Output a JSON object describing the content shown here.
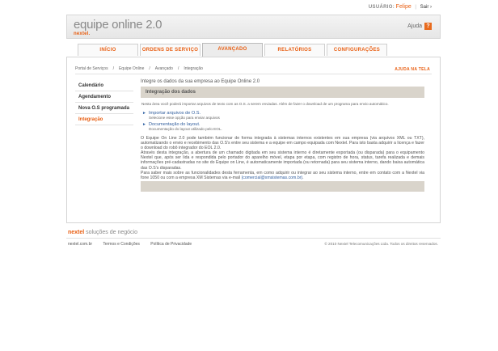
{
  "user_bar": {
    "label": "USUÁRIO:",
    "name": "Felipe",
    "separator": "|",
    "logout": "Sair ›"
  },
  "header": {
    "title": "equipe online 2.0",
    "brand": "nextel.",
    "help_label": "Ajuda",
    "help_icon": "?"
  },
  "tabs": [
    {
      "label": "INÍCIO"
    },
    {
      "label": "ORDENS DE SERVIÇO"
    },
    {
      "label": "AVANÇADO"
    },
    {
      "label": "RELATÓRIOS"
    },
    {
      "label": "CONFIGURAÇÕES"
    }
  ],
  "breadcrumb": [
    "Portal de Serviços",
    "Equipe Online",
    "Avançado",
    "Integração"
  ],
  "breadcrumb_sep": "/",
  "help_screen": "AJUDA NA TELA",
  "sidebar": {
    "items": [
      {
        "label": "Calendário"
      },
      {
        "label": "Agendamento"
      },
      {
        "label": "Nova O.S programada"
      },
      {
        "label": "Integração"
      }
    ]
  },
  "main": {
    "intro": "Integre os dados da sua empresa ao Equipe Online 2.0",
    "box_title": "Integração dos dados",
    "description": "Nesta área você poderá importar arquivos de texto com as O.S. a serem enviadas. Além de fazer o download de um programa para envio automático.",
    "links": [
      {
        "arrow": "►",
        "title": "Importar arquivos de O.S.",
        "subtitle": "Selecione esse opção para enviar arquivos"
      },
      {
        "arrow": "►",
        "title": "Documentação do layout.",
        "subtitle": "Documentação do layout utilizado pelo EOL."
      }
    ],
    "paragraph1": "O Equipe On Line 2.0 pode também funcionar de forma integrada à sistemas internos existentes em sua empresa (via arquivos XML ou TXT), automatizando o envio e recebimento das O.S's entre seu sistema e a equipe em campo equipada com Nextel. Para isto basta adquirir a licença e fazer o download do robô integrador do EOL 2.0.",
    "paragraph2": "Através desta integração, a abertura de um chamado digitada em seu sistema interno é diretamente exportada (ou disparada) para o equipamento Nextel que, após ser lida e respondida pelo portador do aparelho móvel, etapa por etapa, com registro de hora, status, tarefa realizada e demais informações pré-cadastradas no site do Equipe on Line, é automaticamente importada (ou retornada) para seu sistema interno, dando baixa automática das O.S's disparadas.",
    "paragraph3_prefix": "Para saber mais sobre as funcionalidades desta ferramenta, em como adquirir ou integrar ao seu sistema interno, entre em contato com a Nextel via fone 1050 ou com a empresa XM Sistemas via e-mail ",
    "paragraph3_email": "(comercial@xmsistemas.com.br)",
    "paragraph3_suffix": "."
  },
  "footer": {
    "brand_bold": "nextel",
    "brand_rest": " soluções de negócio",
    "links": [
      "nextel.com.br",
      "Termos e Condições",
      "Política de Privacidade"
    ],
    "copyright": "© 2010 Nextel Telecomunicações Ltda. Todos os direitos reservados."
  },
  "colors": {
    "accent": "#e85d10",
    "link": "#2f5d9d",
    "box": "#d9d4cb"
  },
  "active_tab": "AVANÇADO",
  "active_sidebar_item": "Integração"
}
